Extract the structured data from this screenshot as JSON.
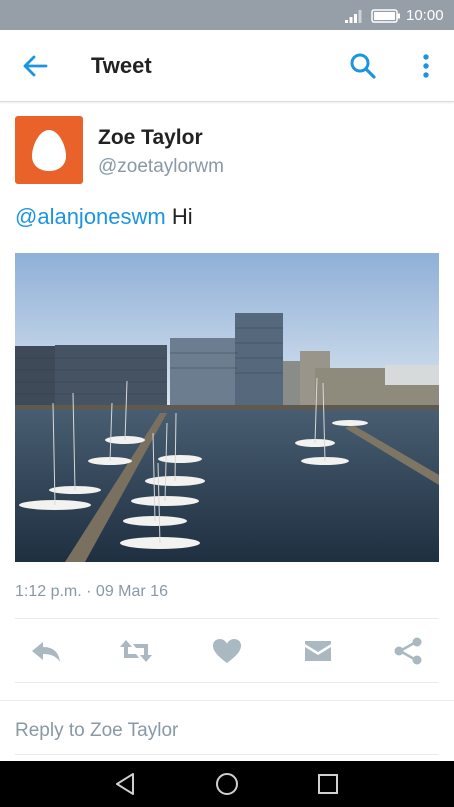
{
  "status_bar": {
    "time": "10:00"
  },
  "app_bar": {
    "title": "Tweet"
  },
  "tweet": {
    "display_name": "Zoe Taylor",
    "handle": "@zoetaylorwm",
    "mention": "@alanjoneswm",
    "text": " Hi",
    "timestamp": "1:12 p.m. · 09 Mar 16"
  },
  "reply": {
    "placeholder": "Reply to Zoe Taylor"
  },
  "colors": {
    "accent": "#1b95e0",
    "avatar_bg": "#e8622a",
    "status_bar": "#969ea7",
    "secondary_text": "#8899a6",
    "action_icon": "#aab8c2"
  },
  "icons": {
    "app_bar": [
      "back-arrow-icon",
      "search-icon",
      "more-vert-icon"
    ],
    "actions": [
      "reply-icon",
      "retweet-icon",
      "heart-icon",
      "envelope-icon",
      "share-icon"
    ],
    "nav": [
      "nav-back-icon",
      "nav-home-icon",
      "nav-recents-icon"
    ]
  }
}
